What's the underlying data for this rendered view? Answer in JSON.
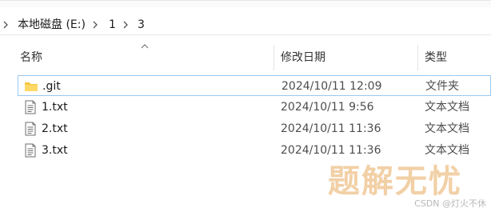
{
  "breadcrumb": {
    "items": [
      "本地磁盘 (E:)",
      "1",
      "3"
    ]
  },
  "columns": {
    "name": "名称",
    "date_modified": "修改日期",
    "type": "类型"
  },
  "files": [
    {
      "name": ".git",
      "date": "2024/10/11 12:09",
      "type": "文件夹",
      "icon": "folder-icon",
      "selected": true
    },
    {
      "name": "1.txt",
      "date": "2024/10/11 9:56",
      "type": "文本文档",
      "icon": "text-file-icon",
      "selected": false
    },
    {
      "name": "2.txt",
      "date": "2024/10/11 11:36",
      "type": "文本文档",
      "icon": "text-file-icon",
      "selected": false
    },
    {
      "name": "3.txt",
      "date": "2024/10/11 11:36",
      "type": "文本文档",
      "icon": "text-file-icon",
      "selected": false
    }
  ],
  "watermark": {
    "logo": "题解无忧",
    "credit": "CSDN @灯火不休"
  },
  "colors": {
    "selection_border": "#99c9f0",
    "folder": "#f5c542",
    "watermark": "#f2d0a6"
  }
}
